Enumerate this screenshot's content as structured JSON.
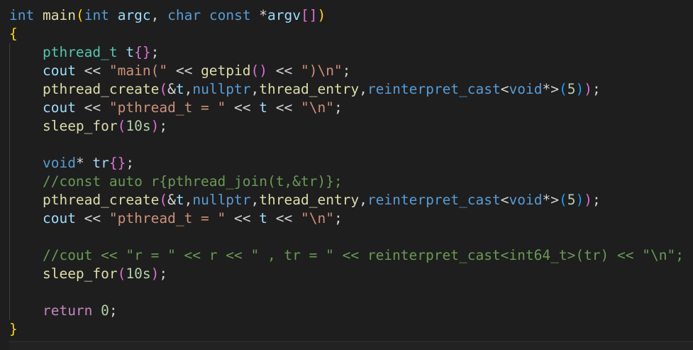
{
  "editor": {
    "theme_colors": {
      "keyword": "#569cd6",
      "function": "#dcdcaa",
      "variable": "#9cdcfe",
      "type": "#4ec9b0",
      "string": "#ce9178",
      "number": "#b5cea8",
      "comment": "#6a9955",
      "control": "#c586c0",
      "bracket1": "#ffd700",
      "bracket2": "#da70d6",
      "bracket3": "#179fff",
      "background": "#1e1e1e"
    },
    "lines": [
      [
        [
          "int",
          "kw"
        ],
        [
          " ",
          "op"
        ],
        [
          "main",
          "fn"
        ],
        [
          "(",
          "br1"
        ],
        [
          "int",
          "kw"
        ],
        [
          " ",
          "op"
        ],
        [
          "argc",
          "var"
        ],
        [
          ", ",
          "op"
        ],
        [
          "char",
          "kw"
        ],
        [
          " ",
          "op"
        ],
        [
          "const",
          "kw"
        ],
        [
          " *",
          "op"
        ],
        [
          "argv",
          "var"
        ],
        [
          "[]",
          "br2"
        ],
        [
          ")",
          "br1"
        ]
      ],
      [
        [
          "{",
          "br1"
        ]
      ],
      [
        [
          "    ",
          "op"
        ],
        [
          "pthread_t",
          "type"
        ],
        [
          " ",
          "op"
        ],
        [
          "t",
          "var"
        ],
        [
          "{}",
          "br2"
        ],
        [
          ";",
          "op"
        ]
      ],
      [
        [
          "    ",
          "op"
        ],
        [
          "cout",
          "var"
        ],
        [
          " << ",
          "op"
        ],
        [
          "\"main(\"",
          "str"
        ],
        [
          " << ",
          "op"
        ],
        [
          "getpid",
          "fn"
        ],
        [
          "()",
          "br2"
        ],
        [
          " << ",
          "op"
        ],
        [
          "\")\\n\"",
          "str"
        ],
        [
          ";",
          "op"
        ]
      ],
      [
        [
          "    ",
          "op"
        ],
        [
          "pthread_create",
          "fn"
        ],
        [
          "(",
          "br2"
        ],
        [
          "&",
          "op"
        ],
        [
          "t",
          "var"
        ],
        [
          ",",
          "op"
        ],
        [
          "nullptr",
          "kw"
        ],
        [
          ",",
          "op"
        ],
        [
          "thread_entry",
          "fn"
        ],
        [
          ",",
          "op"
        ],
        [
          "reinterpret_cast",
          "kw"
        ],
        [
          "<",
          "op"
        ],
        [
          "void",
          "kw"
        ],
        [
          "*>",
          "op"
        ],
        [
          "(",
          "br3"
        ],
        [
          "5",
          "num"
        ],
        [
          ")",
          "br3"
        ],
        [
          ")",
          "br2"
        ],
        [
          ";",
          "op"
        ]
      ],
      [
        [
          "    ",
          "op"
        ],
        [
          "cout",
          "var"
        ],
        [
          " << ",
          "op"
        ],
        [
          "\"pthread_t = \"",
          "str"
        ],
        [
          " << ",
          "op"
        ],
        [
          "t",
          "var"
        ],
        [
          " << ",
          "op"
        ],
        [
          "\"\\n\"",
          "str"
        ],
        [
          ";",
          "op"
        ]
      ],
      [
        [
          "    ",
          "op"
        ],
        [
          "sleep_for",
          "fn"
        ],
        [
          "(",
          "br2"
        ],
        [
          "10s",
          "num"
        ],
        [
          ")",
          "br2"
        ],
        [
          ";",
          "op"
        ]
      ],
      [],
      [
        [
          "    ",
          "op"
        ],
        [
          "void",
          "kw"
        ],
        [
          "* ",
          "op"
        ],
        [
          "tr",
          "var"
        ],
        [
          "{}",
          "br2"
        ],
        [
          ";",
          "op"
        ]
      ],
      [
        [
          "    ",
          "op"
        ],
        [
          "//const auto r{pthread_join(t,&tr)};",
          "cmt"
        ]
      ],
      [
        [
          "    ",
          "op"
        ],
        [
          "pthread_create",
          "fn"
        ],
        [
          "(",
          "br2"
        ],
        [
          "&",
          "op"
        ],
        [
          "t",
          "var"
        ],
        [
          ",",
          "op"
        ],
        [
          "nullptr",
          "kw"
        ],
        [
          ",",
          "op"
        ],
        [
          "thread_entry",
          "fn"
        ],
        [
          ",",
          "op"
        ],
        [
          "reinterpret_cast",
          "kw"
        ],
        [
          "<",
          "op"
        ],
        [
          "void",
          "kw"
        ],
        [
          "*>",
          "op"
        ],
        [
          "(",
          "br3"
        ],
        [
          "5",
          "num"
        ],
        [
          ")",
          "br3"
        ],
        [
          ")",
          "br2"
        ],
        [
          ";",
          "op"
        ]
      ],
      [
        [
          "    ",
          "op"
        ],
        [
          "cout",
          "var"
        ],
        [
          " << ",
          "op"
        ],
        [
          "\"pthread_t = \"",
          "str"
        ],
        [
          " << ",
          "op"
        ],
        [
          "t",
          "var"
        ],
        [
          " << ",
          "op"
        ],
        [
          "\"\\n\"",
          "str"
        ],
        [
          ";",
          "op"
        ]
      ],
      [],
      [
        [
          "    ",
          "op"
        ],
        [
          "//cout << \"r = \" << r << \" , tr = \" << reinterpret_cast<int64_t>(tr) << \"\\n\";",
          "cmt"
        ]
      ],
      [
        [
          "    ",
          "op"
        ],
        [
          "sleep_for",
          "fn"
        ],
        [
          "(",
          "br2"
        ],
        [
          "10s",
          "num"
        ],
        [
          ")",
          "br2"
        ],
        [
          ";",
          "op"
        ]
      ],
      [],
      [
        [
          "    ",
          "op"
        ],
        [
          "return",
          "ctl"
        ],
        [
          " ",
          "op"
        ],
        [
          "0",
          "num"
        ],
        [
          ";",
          "op"
        ]
      ],
      [
        [
          "}",
          "br1"
        ]
      ]
    ]
  }
}
